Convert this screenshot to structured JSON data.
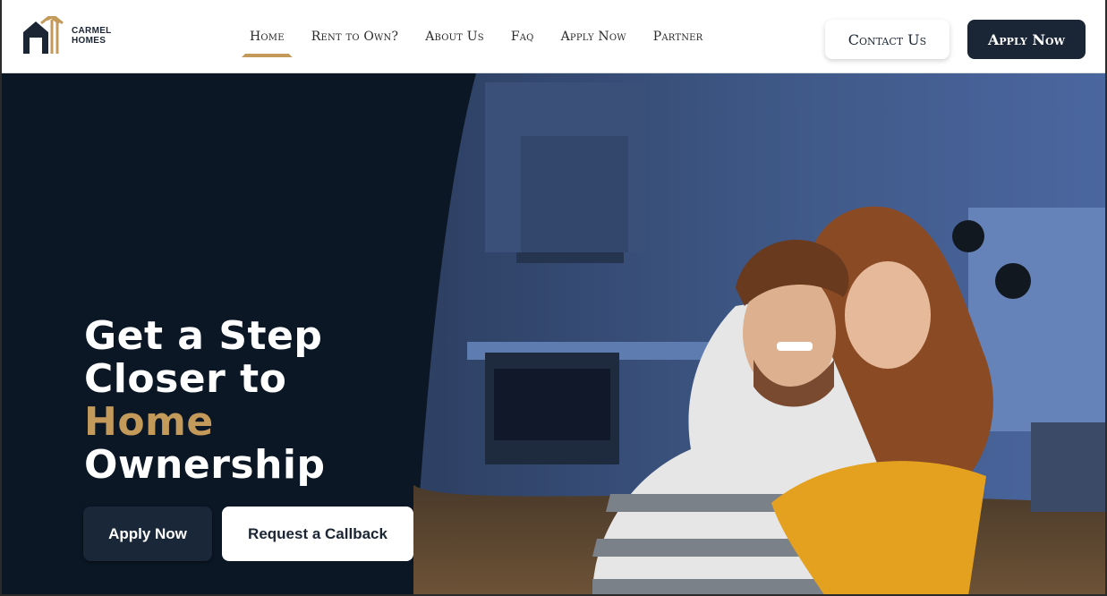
{
  "brand": {
    "line1": "CARMEL",
    "line2": "HOMES",
    "colors": {
      "navy": "#1a2535",
      "gold": "#c49a5b",
      "hero_bg": "#0b1725"
    }
  },
  "nav": {
    "items": [
      {
        "label": "Home",
        "active": true
      },
      {
        "label": "Rent to Own?",
        "active": false
      },
      {
        "label": "About Us",
        "active": false
      },
      {
        "label": "Faq",
        "active": false
      },
      {
        "label": "Apply Now",
        "active": false
      },
      {
        "label": "Partner",
        "active": false
      }
    ],
    "contact_label": "Contact Us",
    "apply_label": "Apply Now"
  },
  "hero": {
    "headline_line1": "Get a Step",
    "headline_line2": "Closer to",
    "headline_accent": "Home",
    "headline_line4": "Ownership",
    "apply_button": "Apply Now",
    "callback_button": "Request a Callback",
    "image": "smiling-couple-in-kitchen-photo"
  }
}
